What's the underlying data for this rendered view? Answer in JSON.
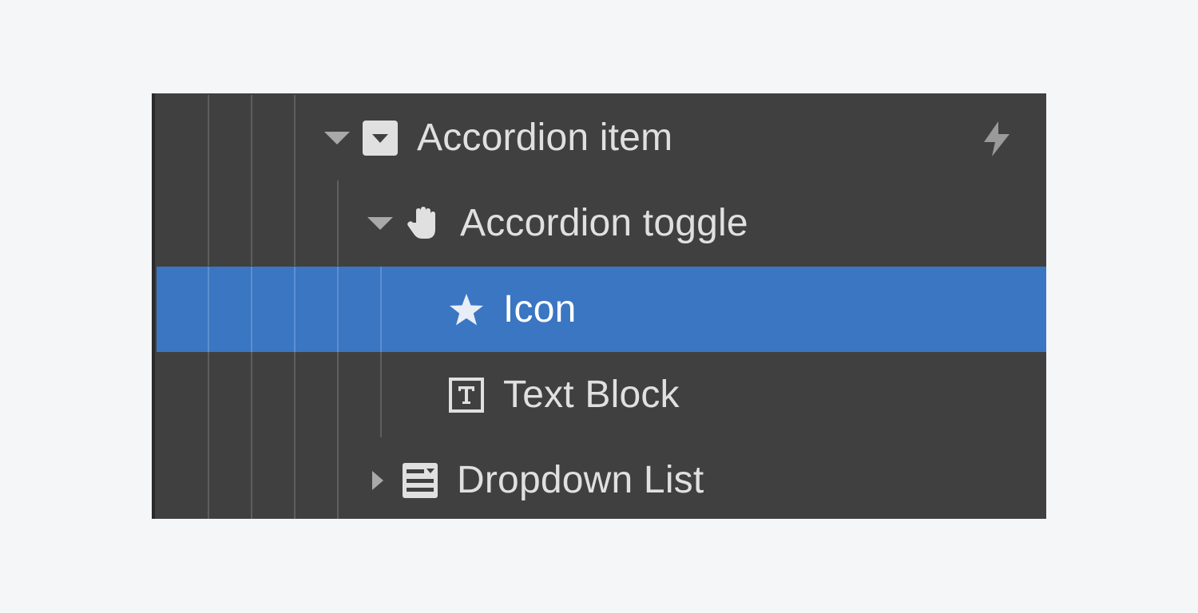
{
  "navigator": {
    "items": [
      {
        "label": "Accordion item",
        "icon": "accordion-item-icon",
        "expanded": true,
        "has_interaction": true
      },
      {
        "label": "Accordion toggle",
        "icon": "hand-pointer-icon",
        "expanded": true
      },
      {
        "label": "Icon",
        "icon": "star-icon",
        "selected": true
      },
      {
        "label": "Text Block",
        "icon": "text-block-icon"
      },
      {
        "label": "Dropdown List",
        "icon": "dropdown-list-icon",
        "expanded": false
      }
    ],
    "interaction_icon": "lightning-bolt-icon"
  },
  "colors": {
    "panel_bg": "#404040",
    "selected_bg": "#3a76c2",
    "page_bg": "#f5f6f8",
    "text": "#e0e0e0",
    "guide": "#5e5e5e"
  }
}
